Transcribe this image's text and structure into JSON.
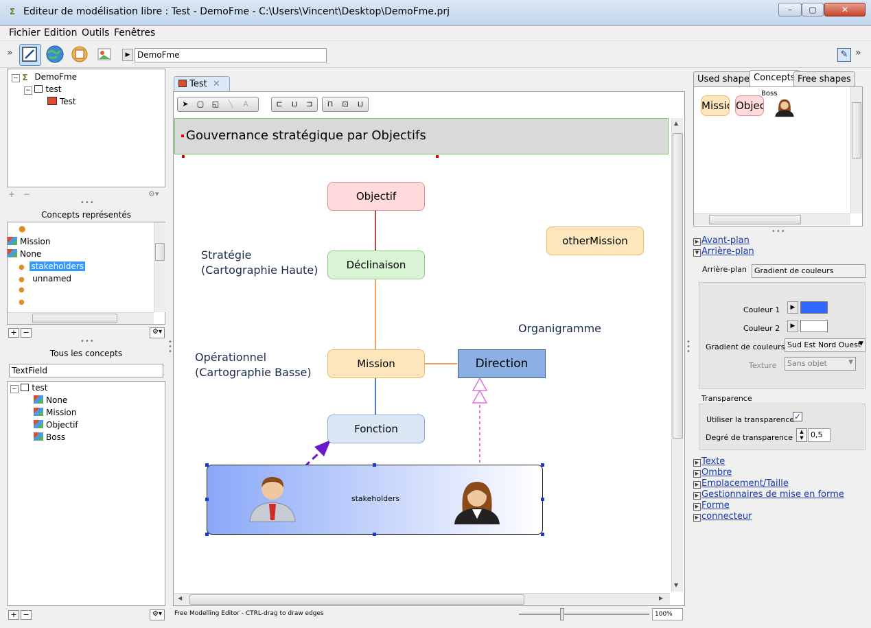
{
  "window": {
    "title": "Editeur de modélisation libre : Test - DemoFme - C:\\Users\\Vincent\\Desktop\\DemoFme.prj",
    "minimize": "–",
    "maximize": "▢",
    "close": "✕"
  },
  "menu": [
    "Fichier",
    "Edition",
    "Outils",
    "Fenêtres"
  ],
  "toolbar": {
    "path_value": "DemoFme"
  },
  "project_tree": {
    "items": [
      {
        "label": "DemoFme"
      },
      {
        "label": "test"
      },
      {
        "label": "Test"
      }
    ]
  },
  "concepts_represented": {
    "title": "Concepts représentés",
    "items": [
      "Mission",
      "None",
      "stakeholders",
      "unnamed"
    ],
    "selected": "stakeholders"
  },
  "all_concepts": {
    "title": "Tous les concepts",
    "filter_value": "TextField",
    "root": "test",
    "items": [
      "None",
      "Mission",
      "Objectif",
      "Boss"
    ]
  },
  "editor": {
    "tab_label": "Test",
    "banner_title": "Gouvernance stratégique par Objectifs",
    "nodes": {
      "objectif": "Objectif",
      "declinaison": "Déclinaison",
      "mission": "Mission",
      "fonction": "Fonction",
      "direction": "Direction",
      "other_mission": "otherMission",
      "stakeholders": "stakeholders"
    },
    "labels": {
      "strategie_line1": "Stratégie",
      "strategie_line2": "(Cartographie Haute)",
      "operationnel_line1": "Opérationnel",
      "operationnel_line2": "(Cartographie Basse)",
      "organigramme": "Organigramme"
    },
    "status_text": "Free Modelling Editor - CTRL-drag to draw edges",
    "zoom": "100%"
  },
  "right_panel": {
    "tabs": [
      "Used shapes",
      "Concepts",
      "Free shapes"
    ],
    "active_tab": "Concepts",
    "palette": {
      "mission": "Missio",
      "objectif": "Objec",
      "boss": "Boss"
    },
    "sections": {
      "avant_plan": "Avant-plan",
      "arriere_plan": "Arrière-plan"
    },
    "arriere_plan": {
      "label": "Arrière-plan",
      "value": "Gradient de couleurs",
      "couleur1_label": "Couleur 1",
      "couleur1": "#3366ff",
      "couleur2_label": "Couleur 2",
      "couleur2": "#ffffff",
      "gradient_label": "Gradient de couleurs",
      "gradient_value": "Sud Est Nord Ouest",
      "texture_label": "Texture",
      "texture_value": "Sans objet"
    },
    "transparence": {
      "title": "Transparence",
      "use_label": "Utiliser la transparence",
      "use_checked": true,
      "degree_label": "Degré de transparence",
      "degree_value": "0,5"
    },
    "more_sections": [
      "Texte",
      "Ombre",
      "Emplacement/Taille",
      "Gestionnaires de mise en forme",
      "Forme",
      "connecteur"
    ]
  }
}
